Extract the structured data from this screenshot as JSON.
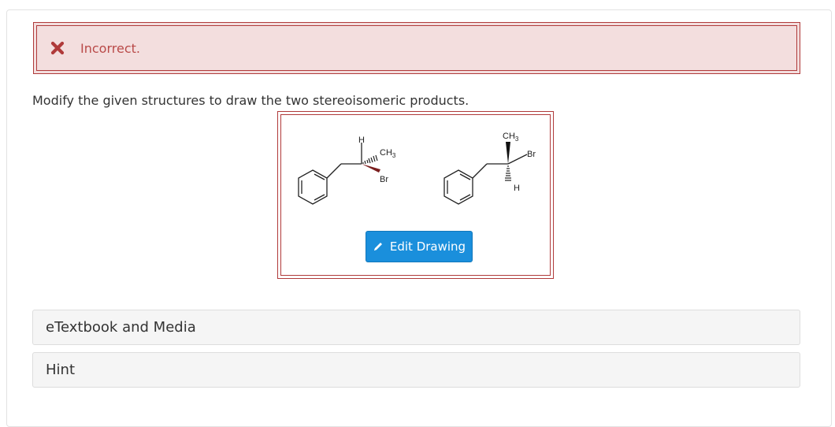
{
  "alert": {
    "icon": "x-icon",
    "text": "Incorrect.",
    "color": "#b94a48",
    "background": "#f3dede"
  },
  "question": {
    "text": "Modify the given structures to draw the two stereoisomeric products."
  },
  "drawing": {
    "molecule_left": {
      "top_label": "H",
      "right_label_main": "CH",
      "right_label_sub": "3",
      "bottom_label": "Br"
    },
    "molecule_right": {
      "top_label_main": "CH",
      "top_label_sub": "3",
      "right_label": "Br",
      "bottom_label": "H"
    },
    "edit_button": {
      "icon": "pencil-icon",
      "label": "Edit Drawing",
      "color": "#1a8fdc"
    }
  },
  "panels": {
    "etextbook_label": "eTextbook and Media",
    "hint_label": "Hint"
  }
}
